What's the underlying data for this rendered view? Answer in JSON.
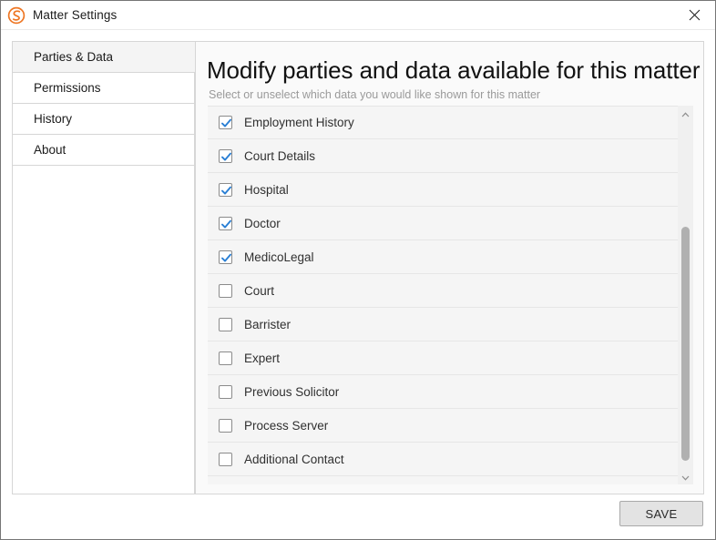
{
  "window": {
    "title": "Matter Settings",
    "logo_icon": "swirl-s-logo-icon",
    "logo_color": "#ee7623",
    "close_icon": "close-icon"
  },
  "sidebar": {
    "items": [
      {
        "label": "Parties & Data",
        "selected": true
      },
      {
        "label": "Permissions",
        "selected": false
      },
      {
        "label": "History",
        "selected": false
      },
      {
        "label": "About",
        "selected": false
      }
    ]
  },
  "main": {
    "heading": "Modify parties and data available for this matter",
    "subheading": "Select or unselect which data you would like shown for this matter",
    "list": [
      {
        "label": "Employment History",
        "checked": true
      },
      {
        "label": "Court Details",
        "checked": true
      },
      {
        "label": "Hospital",
        "checked": true
      },
      {
        "label": "Doctor",
        "checked": true
      },
      {
        "label": "MedicoLegal",
        "checked": true
      },
      {
        "label": "Court",
        "checked": false
      },
      {
        "label": "Barrister",
        "checked": false
      },
      {
        "label": "Expert",
        "checked": false
      },
      {
        "label": "Previous Solicitor",
        "checked": false
      },
      {
        "label": "Process Server",
        "checked": false
      },
      {
        "label": "Additional Contact",
        "checked": false
      }
    ],
    "scrollbar": {
      "up_icon": "chevron-up-icon",
      "down_icon": "chevron-down-icon"
    }
  },
  "footer": {
    "save_label": "SAVE"
  },
  "colors": {
    "accent": "#ee7623",
    "checkmark": "#2a7fd4",
    "panel_bg": "#fafafa",
    "list_bg": "#f5f5f5",
    "selected_tab_bg": "#f4f4f4"
  }
}
